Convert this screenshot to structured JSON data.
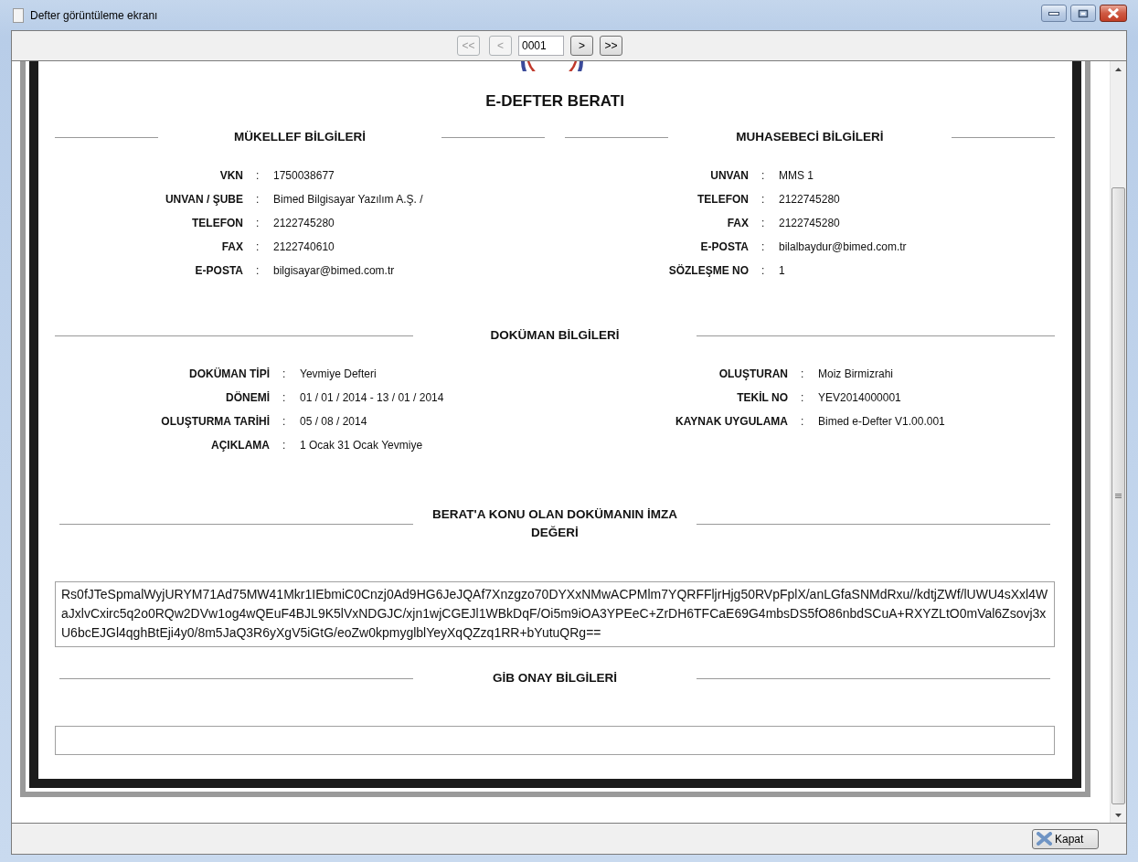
{
  "window": {
    "title": "Defter görüntüleme ekranı"
  },
  "navigation": [
    {
      "kind": "button",
      "label": "<<",
      "disabled": true
    },
    {
      "kind": "button",
      "label": "<",
      "disabled": true
    },
    {
      "kind": "field",
      "value": "0001"
    },
    {
      "kind": "button",
      "label": ">",
      "disabled": false
    },
    {
      "kind": "button",
      "label": ">>",
      "disabled": false
    }
  ],
  "document": {
    "title": "E-DEFTER BERATI",
    "party_sections": [
      {
        "heading": "MÜKELLEF BİLGİLERİ",
        "rows": [
          {
            "label": "VKN",
            "sep": ":",
            "value": "1750038677"
          },
          {
            "label": "UNVAN / ŞUBE",
            "sep": ":",
            "value": "Bimed Bilgisayar Yazılım A.Ş. /"
          },
          {
            "label": "TELEFON",
            "sep": ":",
            "value": "2122745280"
          },
          {
            "label": "FAX",
            "sep": ":",
            "value": "2122740610"
          },
          {
            "label": "E-POSTA",
            "sep": ":",
            "value": "bilgisayar@bimed.com.tr"
          }
        ]
      },
      {
        "heading": "MUHASEBECİ BİLGİLERİ",
        "rows": [
          {
            "label": "UNVAN",
            "sep": ":",
            "value": "MMS 1"
          },
          {
            "label": "TELEFON",
            "sep": ":",
            "value": "2122745280"
          },
          {
            "label": "FAX",
            "sep": ":",
            "value": "2122745280"
          },
          {
            "label": "E-POSTA",
            "sep": ":",
            "value": "bilalbaydur@bimed.com.tr"
          },
          {
            "label": "SÖZLEŞME NO",
            "sep": ":",
            "value": "1"
          }
        ]
      }
    ],
    "document_section": {
      "heading": "DOKÜMAN BİLGİLERİ",
      "columns": [
        [
          {
            "label": "DOKÜMAN TİPİ",
            "sep": ":",
            "value": "Yevmiye Defteri"
          },
          {
            "label": "DÖNEMİ",
            "sep": ":",
            "value": "01 / 01 / 2014 - 13 / 01 / 2014"
          },
          {
            "label": "OLUŞTURMA TARİHİ",
            "sep": ":",
            "value": "05 / 08 / 2014"
          },
          {
            "label": "AÇIKLAMA",
            "sep": ":",
            "value": "1 Ocak 31 Ocak Yevmiye"
          }
        ],
        [
          {
            "label": "OLUŞTURAN",
            "sep": ":",
            "value": "Moiz Birmizrahi"
          },
          {
            "label": "TEKİL NO",
            "sep": ":",
            "value": "YEV2014000001"
          },
          {
            "label": "KAYNAK UYGULAMA",
            "sep": ":",
            "value": "Bimed e-Defter V1.00.001"
          }
        ]
      ]
    },
    "signature": {
      "heading": "BERAT'A KONU OLAN DOKÜMANIN İMZA DEĞERİ",
      "value": "Rs0fJTeSpmalWyjURYM71Ad75MW41Mkr1IEbmiC0Cnzj0Ad9HG6JeJQAf7Xnzgzo70DYXxNMwACPMlm7YQRFFljrHjg50RVpFplX/anLGfaSNMdRxu//kdtjZWf/lUWU4sXxl4WaJxlvCxirc5q2o0RQw2DVw1og4wQEuF4BJL9K5lVxNDGJC/xjn1wjCGEJl1WBkDqF/Oi5m9iOA3YPEeC+ZrDH6TFCaE69G4mbsDS5fO86nbdSCuA+RXYZLtO0mVal6Zsovj3xU6bcEJGl4qghBtEji4y0/8m5JaQ3R6yXgV5iGtG/eoZw0kpmyglblYeyXqQZzq1RR+bYutuQRg=="
    },
    "approval": {
      "heading": "GİB ONAY BİLGİLERİ"
    }
  },
  "footer": {
    "close_button": "Kapat"
  }
}
